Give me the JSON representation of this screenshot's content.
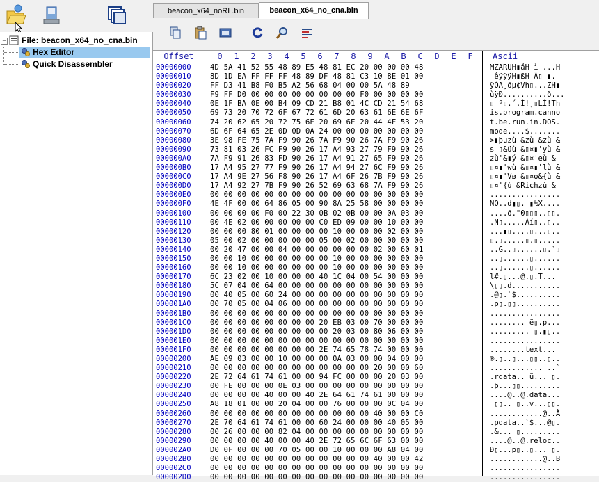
{
  "toolbar": {
    "buttons": [
      {
        "name": "open-file-icon"
      },
      {
        "name": "save-file-icon"
      },
      {
        "name": "windows-icon"
      }
    ]
  },
  "tree": {
    "file_label": "File: beacon_x64_no_cna.bin",
    "items": [
      {
        "label": "Hex Editor",
        "selected": true
      },
      {
        "label": "Quick Disassembler",
        "selected": false
      }
    ]
  },
  "tabs": [
    {
      "label": "beacon_x64_noRL.bin",
      "active": false
    },
    {
      "label": "beacon_x64_no_cna.bin",
      "active": true
    }
  ],
  "hex_toolbar": [
    {
      "name": "copy-icon"
    },
    {
      "name": "paste-icon"
    },
    {
      "name": "select-icon"
    },
    {
      "name": "goto-icon"
    },
    {
      "name": "search-icon"
    },
    {
      "name": "bytes-icon"
    }
  ],
  "hex": {
    "offset_header": "Offset",
    "ascii_header": "Ascii",
    "columns": [
      "0",
      "1",
      "2",
      "3",
      "4",
      "5",
      "6",
      "7",
      "8",
      "9",
      "A",
      "B",
      "C",
      "D",
      "E",
      "F"
    ],
    "rows": [
      {
        "off": "00000000",
        "hex": "4D 5A 41 52 55 48 89 E5 48 81 EC 20 00 00 00 48",
        "asc": "MZARUH▮åH ì ...H"
      },
      {
        "off": "00000010",
        "hex": "8D 1D EA FF FF FF 48 89 DF 48 81 C3 10 8E 01 00",
        "asc": " êÿÿÿH▮ßH Ã▯ ▮."
      },
      {
        "off": "00000020",
        "hex": "FF D3 41 B8 F0 B5 A2 56 68 04 00 00 5A 48 89 ",
        "asc": "ÿÓA¸ðµ¢Vh▯...ZH▮"
      },
      {
        "off": "00000030",
        "hex": "F9 FF D0 00 00 00 00 00 00 00 00 F0 00 00 00 00",
        "asc": "ùÿÐ..........ð..."
      },
      {
        "off": "00000040",
        "hex": "0E 1F BA 0E 00 B4 09 CD 21 B8 01 4C CD 21 54 68",
        "asc": "▯ º▯.´.Í!¸▯LÍ!Th"
      },
      {
        "off": "00000050",
        "hex": "69 73 20 70 72 6F 67 72 61 6D 20 63 61 6E 6E 6F",
        "asc": "is.program.canno"
      },
      {
        "off": "00000060",
        "hex": "74 20 62 65 20 72 75 6E 20 69 6E 20 44 4F 53 20",
        "asc": "t.be.run.in.DOS."
      },
      {
        "off": "00000070",
        "hex": "6D 6F 64 65 2E 0D 0D 0A 24 00 00 00 00 00 00 00",
        "asc": "mode....$......."
      },
      {
        "off": "00000080",
        "hex": "3E 98 FE 75 7A F9 90 26 7A F9 90 26 7A F9 90 26",
        "asc": ">▮þuzù &zù &zù &"
      },
      {
        "off": "00000090",
        "hex": "73 81 03 26 FC F9 90 26 17 A4 93 27 79 F9 90 26",
        "asc": "s ▯&üù &▯¤▮'yù &"
      },
      {
        "off": "000000A0",
        "hex": "7A F9 91 26 83 FD 90 26 17 A4 91 27 65 F9 90 26",
        "asc": "zù'&▮ý &▯¤'eù &"
      },
      {
        "off": "000000B0",
        "hex": "17 A4 95 27 77 F9 90 26 17 A4 94 27 6C F9 90 26",
        "asc": "▯¤▮'wù &▯¤▮'lù &"
      },
      {
        "off": "000000C0",
        "hex": "17 A4 9E 27 56 F8 90 26 17 A4 6F 26 7B F9 90 26",
        "asc": "▯¤▮'Vø &▯¤o&{ù &"
      },
      {
        "off": "000000D0",
        "hex": "17 A4 92 27 7B F9 90 26 52 69 63 68 7A F9 90 26",
        "asc": "▯¤'{ù &Richzù &"
      },
      {
        "off": "000000E0",
        "hex": "00 00 00 00 00 00 00 00 00 00 00 00 00 00 00 00",
        "asc": "................"
      },
      {
        "off": "000000F0",
        "hex": "4E 4F 00 00 64 86 05 00 90 8A 25 58 00 00 00 00",
        "asc": "NO..d▮▯. ▮%X...."
      },
      {
        "off": "00000100",
        "hex": "00 00 00 00 F0 00 22 30 0B 02 0B 00 00 0A 03 00",
        "asc": "....ð.\"0▯▯▯..▯▯."
      },
      {
        "off": "00000110",
        "hex": "00 4E 02 00 00 00 00 00 C0 ED 09 00 00 10 00 00",
        "asc": ".N▯.....Àí▯..▯.."
      },
      {
        "off": "00000120",
        "hex": "00 00 00 80 01 00 00 00 00 10 00 00 00 02 00 00",
        "asc": "...▮▯....▯...▯.."
      },
      {
        "off": "00000130",
        "hex": "05 00 02 00 00 00 00 00 05 00 02 00 00 00 00 00",
        "asc": "▯.▯.....▯.▯....."
      },
      {
        "off": "00000140",
        "hex": "00 20 47 00 00 04 00 00 00 00 00 00 02 00 60 01",
        "asc": "..G..▯......▯.`▯"
      },
      {
        "off": "00000150",
        "hex": "00 00 10 00 00 00 00 00 00 10 00 00 00 00 00 00",
        "asc": "..▯......▯......"
      },
      {
        "off": "00000160",
        "hex": "00 00 10 00 00 00 00 00 00 10 00 00 00 00 00 00",
        "asc": "..▯......▯......"
      },
      {
        "off": "00000170",
        "hex": "6C 23 02 00 10 00 00 00 40 1C 04 00 54 00 00 00",
        "asc": "l#.▯...@.▯.T..."
      },
      {
        "off": "00000180",
        "hex": "5C 07 04 00 64 00 00 00 00 00 00 00 00 00 00 00",
        "asc": "\\▯▯.d..........."
      },
      {
        "off": "00000190",
        "hex": "00 40 05 00 60 24 00 00 00 00 00 00 00 00 00 00",
        "asc": ".@▯.`$.........."
      },
      {
        "off": "000001A0",
        "hex": "00 70 05 00 04 06 00 00 00 00 00 00 00 00 00 00",
        "asc": ".p▯.▯▯.........."
      },
      {
        "off": "000001B0",
        "hex": "00 00 00 00 00 00 00 00 00 00 00 00 00 00 00 00",
        "asc": "................"
      },
      {
        "off": "000001C0",
        "hex": "00 00 00 00 00 00 00 00 20 EB 03 00 70 00 00 00",
        "asc": "........ ë▯.p..."
      },
      {
        "off": "000001D0",
        "hex": "00 00 00 00 00 00 00 00 00 20 03 00 80 06 00 00",
        "asc": "......... ▯.▮▯.."
      },
      {
        "off": "000001E0",
        "hex": "00 00 00 00 00 00 00 00 00 00 00 00 00 00 00 00",
        "asc": "................"
      },
      {
        "off": "000001F0",
        "hex": "00 00 00 00 00 00 00 00 2E 74 65 78 74 00 00 00",
        "asc": "........text..."
      },
      {
        "off": "00000200",
        "hex": "AE 09 03 00 00 10 00 00 00 0A 03 00 00 04 00 00",
        "asc": "®.▯..▯...▯▯..▯.."
      },
      {
        "off": "00000210",
        "hex": "00 00 00 00 00 00 00 00 00 00 00 00 20 00 00 60",
        "asc": "............ ..`"
      },
      {
        "off": "00000220",
        "hex": "2E 72 64 61 74 61 00 00 94 FC 00 00 00 20 03 00",
        "asc": ".rdata.. ü... ▯."
      },
      {
        "off": "00000230",
        "hex": "00 FE 00 00 00 0E 03 00 00 00 00 00 00 00 00 00",
        "asc": ".þ...▯▯........."
      },
      {
        "off": "00000240",
        "hex": "00 00 00 00 40 00 00 40 2E 64 61 74 61 00 00 00",
        "asc": "....@..@.data..."
      },
      {
        "off": "00000250",
        "hex": "A8 18 01 00 00 20 04 00 00 76 00 00 00 0C 04 00",
        "asc": "¨▯▯.. ▯..v...▯▯."
      },
      {
        "off": "00000260",
        "hex": "00 00 00 00 00 00 00 00 00 00 00 00 40 00 00 C0",
        "asc": "............@..À"
      },
      {
        "off": "00000270",
        "hex": "2E 70 64 61 74 61 00 00 60 24 00 00 00 40 05 00",
        "asc": ".pdata..`$...@▯."
      },
      {
        "off": "00000280",
        "hex": "00 26 00 00 00 82 04 00 00 00 00 00 00 00 00 00",
        "asc": ".&... ▯........."
      },
      {
        "off": "00000290",
        "hex": "00 00 00 00 40 00 00 40 2E 72 65 6C 6F 63 00 00",
        "asc": "....@..@.reloc.."
      },
      {
        "off": "000002A0",
        "hex": "D0 0F 00 00 00 70 05 00 00 10 00 00 00 A8 04 00",
        "asc": "Ð▯...p▯..▯...¨▯."
      },
      {
        "off": "000002B0",
        "hex": "00 00 00 00 00 00 00 00 00 00 00 00 40 00 00 42",
        "asc": "............@..B"
      },
      {
        "off": "000002C0",
        "hex": "00 00 00 00 00 00 00 00 00 00 00 00 00 00 00 00",
        "asc": "................"
      },
      {
        "off": "000002D0",
        "hex": "00 00 00 00 00 00 00 00 00 00 00 00 00 00 00 00",
        "asc": "................"
      }
    ]
  }
}
